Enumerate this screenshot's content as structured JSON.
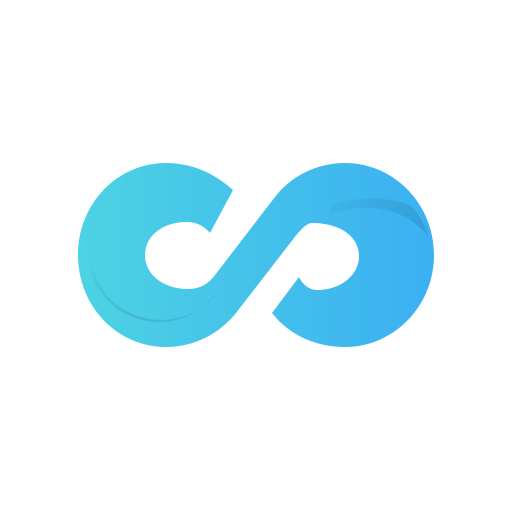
{
  "logo": {
    "icon": "infinity-loop-logo",
    "colors": {
      "background": "#ffffff",
      "gradient_start": "#4dd3e3",
      "gradient_end": "#3bb0f2",
      "shadow": "#2a8fc4"
    }
  }
}
